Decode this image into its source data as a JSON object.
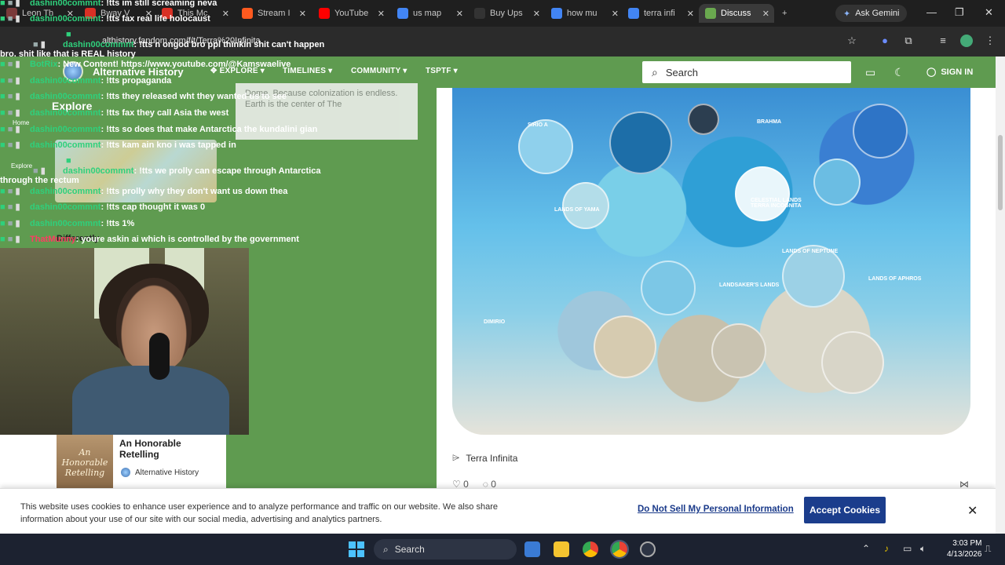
{
  "browser": {
    "tabs": [
      {
        "label": "Leon Th",
        "color": "#7a3a3a"
      },
      {
        "label": "Bway V",
        "color": "#d93025"
      },
      {
        "label": "This Mc",
        "color": "#d93025"
      },
      {
        "label": "Stream I",
        "color": "#ff5a1f"
      },
      {
        "label": "YouTube",
        "color": "#ff0000"
      },
      {
        "label": "us map",
        "color": "#4285f4"
      },
      {
        "label": "Buy Ups",
        "color": "#333333"
      },
      {
        "label": "how mu",
        "color": "#4285f4"
      },
      {
        "label": "terra infi",
        "color": "#4285f4"
      },
      {
        "label": "Discuss",
        "color": "#6aa84f"
      }
    ],
    "ask_gemini": "Ask Gemini",
    "url": "althistory.fandom.com/f/t/Terra%20Infinita"
  },
  "site": {
    "name": "Alternative History",
    "nav": [
      "EXPLORE",
      "TIMELINES",
      "COMMUNITY",
      "TSPTF"
    ],
    "search_placeholder": "Search",
    "signin": "SIGN IN"
  },
  "sidebar": {
    "explore": "Explore",
    "home": "Home",
    "explore_small": "Explore",
    "quote": "Dome. Because colonization is endless. Earth is the center of The",
    "differently": "Differently"
  },
  "chat": [
    {
      "nick": "dashin00commnt",
      "msg": ": !tts im still screaming neva",
      "red": false
    },
    {
      "nick": "dashin00commnt",
      "msg": ": !tts fax real life holocaust",
      "red": false
    },
    {
      "nick": "dashin00commnt",
      "msg": ": !tts n ongod bro ppl thinkin shit can't happen bro. shit like that is REAL history",
      "red": false
    },
    {
      "nick": "BotRix",
      "msg": ": New Content! https://www.youtube.com/@Kamswaelive",
      "red": false
    },
    {
      "nick": "dashin00commnt",
      "msg": ": !tts propaganda",
      "red": false
    },
    {
      "nick": "dashin00commnt",
      "msg": ": !tts they released wht they wanted us to see",
      "red": false
    },
    {
      "nick": "dashin00commnt",
      "msg": ": !tts fax they call Asia the west",
      "red": false
    },
    {
      "nick": "dashin00commnt",
      "msg": ": !tts so does that make Antarctica the kundalini gian",
      "red": false
    },
    {
      "nick": "dashin00commnt",
      "msg": ": !tts kam ain kno i was tapped in",
      "red": false
    },
    {
      "nick": "dashin00commnt",
      "msg": ": !tts we prolly can escape through Antarctica through the rectum",
      "red": false
    },
    {
      "nick": "dashin00commnt",
      "msg": ": !tts prolly why they don't want us down thea",
      "red": false
    },
    {
      "nick": "dashin00commnt",
      "msg": ": !tts cap thought it was 0",
      "red": false
    },
    {
      "nick": "dashin00commnt",
      "msg": ": !tts 1%",
      "red": false
    },
    {
      "nick": "ThatMunny",
      "msg": ": youre askin ai which is controlled by the government",
      "red": true
    }
  ],
  "book": {
    "cover_text": "An Honorable Retelling",
    "title": "An Honorable Retelling",
    "community": "Alternative History"
  },
  "post": {
    "map_labels": [
      "SIRIO A",
      "BRAHMA",
      "LANDS OF YAMA",
      "CELESTIAL LANDS TERRA INCOGNITA",
      "LANDS OF NEPTUNE",
      "DIMIRIO",
      "LANDSAKER'S LANDS",
      "LANDS OF APHROS"
    ],
    "tag": "Terra Infinita",
    "likes": "0",
    "comments": "0"
  },
  "cookie": {
    "text": "This website uses cookies to enhance user experience and to analyze performance and traffic on our website. We also share information about your use of our site with our social media, advertising and analytics partners.",
    "link": "Do Not Sell My Personal Information",
    "accept": "Accept Cookies"
  },
  "taskbar": {
    "search": "Search",
    "time": "3:03 PM",
    "date": "4/13/2026"
  }
}
